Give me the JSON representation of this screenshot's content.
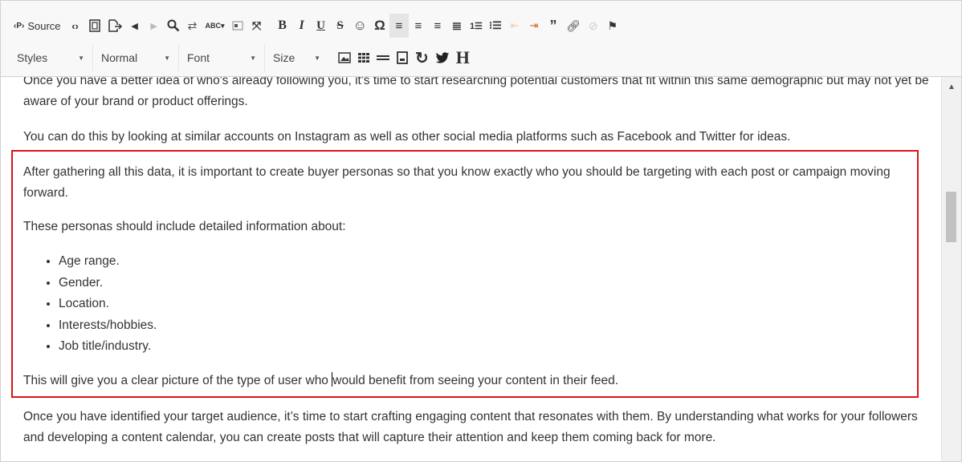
{
  "toolbar": {
    "source_label": "Source",
    "styles_label": "Styles",
    "format_label": "Normal",
    "font_label": "Font",
    "size_label": "Size",
    "bold": "B",
    "italic": "I",
    "underline": "U",
    "strike": "S",
    "omega": "Ω",
    "header_h": "H"
  },
  "content": {
    "p1": "Once you have a better idea of who's already following you, it's time to start researching potential customers that fit within this same demographic but may not yet be aware of your brand or product offerings.",
    "p2": "You can do this by looking at similar accounts on Instagram as well as other social media platforms such as Facebook and Twitter for ideas.",
    "p3": "After gathering all this data, it is important to create buyer personas so that you know exactly who you should be targeting with each post or campaign moving forward.",
    "p4": "These personas should include detailed information about:",
    "bullets": [
      "Age range.",
      "Gender.",
      "Location.",
      "Interests/hobbies.",
      "Job title/industry."
    ],
    "p5_before": "This will give you a clear picture of the type of user who ",
    "p5_after": "would benefit from seeing your content in their feed.",
    "p6": "Once you have identified your target audience, it’s time to start crafting engaging content that resonates with them. By understanding what works for your followers and developing a content calendar, you can create posts that will capture their attention and keep them coming back for more."
  },
  "colors": {
    "selection_border": "#d9151a",
    "toolbar_bg": "#f8f8f8",
    "text": "#333333"
  }
}
